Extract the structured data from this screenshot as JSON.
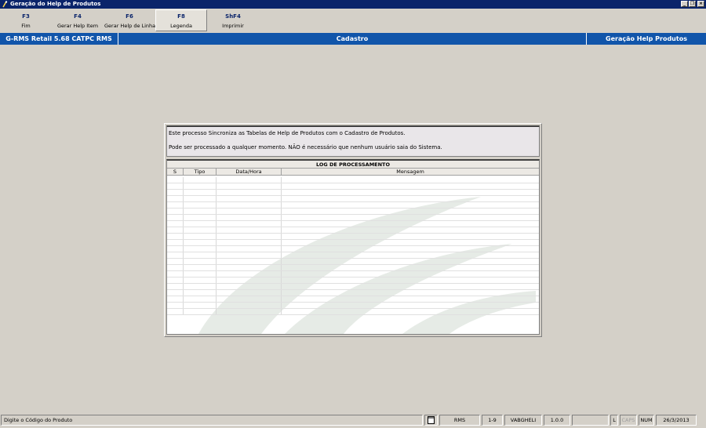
{
  "window": {
    "title": "Geração do Help de Produtos"
  },
  "toolbar": {
    "buttons": [
      {
        "key": "F3",
        "label": "Fim"
      },
      {
        "key": "F4",
        "label": "Gerar Help Item"
      },
      {
        "key": "F6",
        "label": "Gerar Help de Linhas"
      },
      {
        "key": "F8",
        "label": "Legenda"
      },
      {
        "key": "ShF4",
        "label": "Imprimir"
      }
    ]
  },
  "infobar": {
    "system": "G-RMS Retail 5.68 CATPC RMS",
    "module": "Cadastro",
    "screen": "Geração Help Produtos"
  },
  "message": {
    "line1": "Este processo Sincroniza as Tabelas de Help de Produtos com o Cadastro de Produtos.",
    "line2": "Pode ser processado a qualquer momento. NÃO é necessário que nenhum usuário saia do Sistema."
  },
  "log": {
    "title": "LOG DE PROCESSAMENTO",
    "columns": [
      "S",
      "Tipo",
      "Data/Hora",
      "Mensagem"
    ]
  },
  "statusbar": {
    "hint": "Digite o Código do Produto",
    "system": "RMS",
    "version_code": "1-9",
    "user": "VABGHELI",
    "version": "1.0.0",
    "blank": "",
    "lock": "L",
    "caps": "CAPS",
    "num": "NUM",
    "date": "26/3/2013"
  },
  "colors": {
    "titlebar": "#0a246a",
    "infobar": "#1155aa",
    "background": "#d4d0c8"
  }
}
